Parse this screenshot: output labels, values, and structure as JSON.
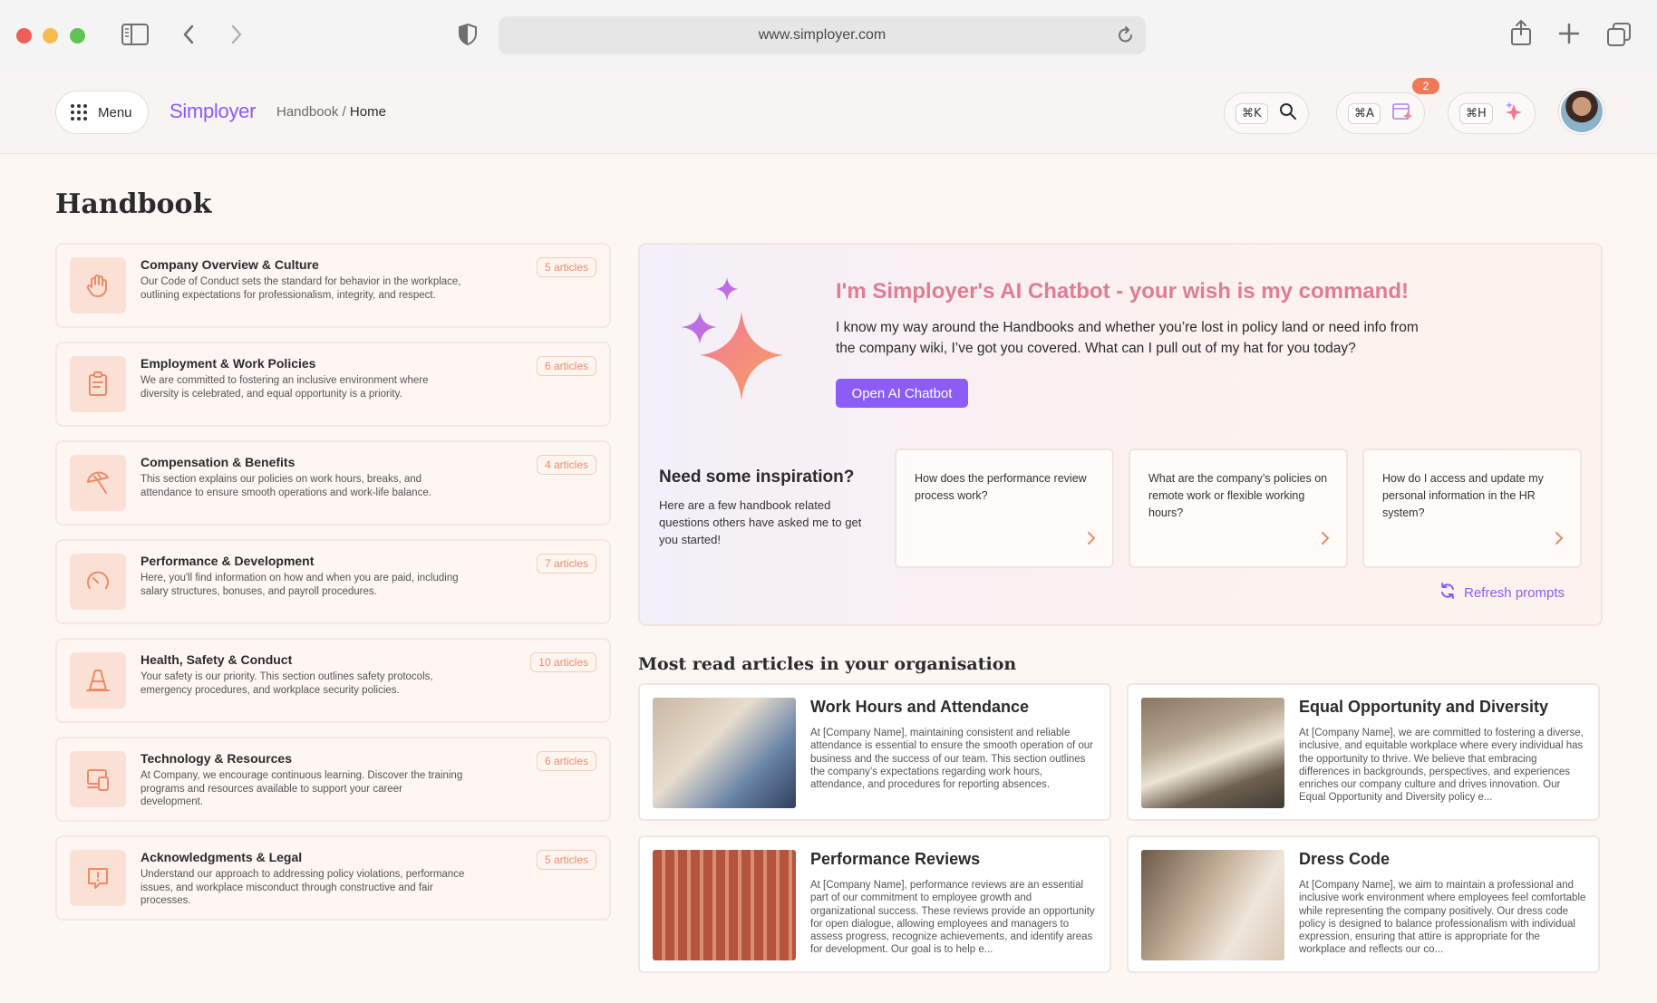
{
  "browser": {
    "url": "www.simployer.com",
    "icons": [
      "sidebar-icon",
      "back-icon",
      "forward-icon",
      "shield-icon",
      "reload-icon",
      "share-icon",
      "new-tab-icon",
      "tabs-icon"
    ]
  },
  "header": {
    "menu_label": "Menu",
    "logo": "Simployer",
    "breadcrumb_parent": "Handbook /",
    "breadcrumb_current": "Home",
    "search_shortcut": "⌘K",
    "apps_shortcut": "⌘A",
    "apps_badge": "2",
    "ai_shortcut": "⌘H"
  },
  "page": {
    "title": "Handbook"
  },
  "categories": [
    {
      "title": "Company Overview & Culture",
      "desc": "Our Code of Conduct sets the standard for behavior in the workplace, outlining expectations for professionalism, integrity, and respect.",
      "count": "5 articles",
      "icon": "hand-icon"
    },
    {
      "title": "Employment & Work Policies",
      "desc": "We are committed to fostering an inclusive environment where diversity is celebrated, and equal opportunity is a priority.",
      "count": "6 articles",
      "icon": "clipboard-icon"
    },
    {
      "title": "Compensation & Benefits",
      "desc": "This section explains our policies on work hours, breaks, and attendance to ensure smooth operations and work-life balance.",
      "count": "4 articles",
      "icon": "umbrella-icon"
    },
    {
      "title": "Performance & Development",
      "desc": "Here, you'll find information on how and when you are paid, including salary structures, bonuses, and payroll procedures.",
      "count": "7 articles",
      "icon": "gauge-icon"
    },
    {
      "title": "Health, Safety & Conduct",
      "desc": "Your safety is our priority. This section outlines safety protocols, emergency procedures, and workplace security policies.",
      "count": "10 articles",
      "icon": "cone-icon"
    },
    {
      "title": "Technology & Resources",
      "desc": "At Company, we encourage continuous learning. Discover the training programs and resources available to support your career development.",
      "count": "6 articles",
      "icon": "devices-icon"
    },
    {
      "title": "Acknowledgments & Legal",
      "desc": "Understand our approach to addressing policy violations, performance issues, and workplace misconduct through constructive and fair processes.",
      "count": "5 articles",
      "icon": "alert-icon"
    }
  ],
  "ai": {
    "title": "I'm Simployer's AI Chatbot - your wish is my command!",
    "text": "I know my way around the Handbooks and whether you’re lost in policy land or need info from the company wiki, I’ve got you covered. What can I pull out of my hat for you today?",
    "button": "Open AI Chatbot",
    "inspiration_title": "Need some inspiration?",
    "inspiration_text": "Here are a few handbook related questions others have asked me to get you started!",
    "prompts": [
      "How does the performance review process work?",
      "What are the company’s policies on remote work or flexible working hours?",
      "How do I access and update my personal information in the HR system?"
    ],
    "refresh": "Refresh prompts"
  },
  "articles": {
    "heading": "Most read articles in your organisation",
    "items": [
      {
        "title": "Work Hours and Attendance",
        "text": "At [Company Name], maintaining consistent and reliable attendance is essential to ensure the smooth operation of our business and the success of our team. This section outlines the company’s expectations regarding work hours, attendance, and procedures for reporting absences."
      },
      {
        "title": "Equal Opportunity and Diversity",
        "text": "At [Company Name], we are committed to fostering a diverse, inclusive, and equitable workplace where every individual has the opportunity to thrive. We believe that embracing differences in backgrounds, perspectives, and experiences enriches our company culture and drives innovation. Our Equal Opportunity and Diversity policy e..."
      },
      {
        "title": "Performance Reviews",
        "text": "At [Company Name], performance reviews are an essential part of our commitment to employee growth and organizational success. These reviews provide an opportunity for open dialogue, allowing employees and managers to assess progress, recognize achievements, and identify areas for development. Our goal is to help e..."
      },
      {
        "title": "Dress Code",
        "text": "At [Company Name], we aim to maintain a professional and inclusive work environment where employees feel comfortable while representing the company positively. Our dress code policy is designed to balance professionalism with individual expression, ensuring that attire is appropriate for the workplace and reflects our co..."
      }
    ]
  },
  "colors": {
    "accent": "#8b5cf6",
    "coral": "#ec8b66",
    "ai_title": "#e07c93"
  }
}
